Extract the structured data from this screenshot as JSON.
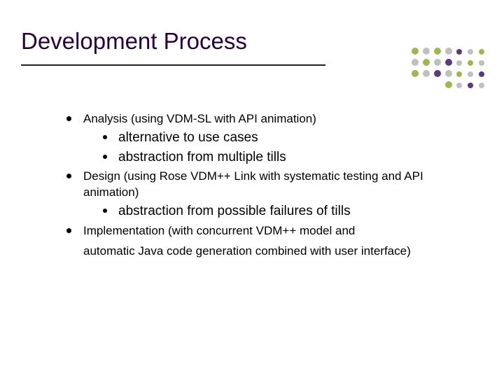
{
  "title": "Development Process",
  "bullets": [
    {
      "text": "Analysis (using VDM-SL with API animation)",
      "sub": [
        "alternative to use cases",
        "abstraction from multiple tills"
      ]
    },
    {
      "text": "Design (using Rose VDM++ Link with systematic testing and API animation)",
      "sub": [
        "abstraction from possible failures of tills"
      ]
    },
    {
      "text": "Implementation (with concurrent VDM++ model and",
      "sub": []
    }
  ],
  "continuation": "automatic Java code generation combined with user interface)",
  "deco_colors": {
    "green": "#9fb84e",
    "gray": "#bfbfbf",
    "purple": "#5a3a7a"
  }
}
